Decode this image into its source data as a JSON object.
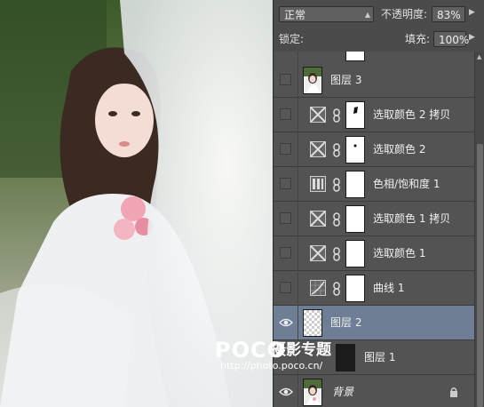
{
  "layers_panel": {
    "blend_mode": "正常",
    "opacity_label": "不透明度:",
    "opacity_value": "83%",
    "lock_label": "锁定:",
    "fill_label": "填充:",
    "fill_value": "100%",
    "layers": [
      {
        "name": "图层 3",
        "type": "pixel",
        "visible": false
      },
      {
        "name": "选取颜色 2 拷贝",
        "type": "selective-color",
        "visible": false
      },
      {
        "name": "选取颜色 2",
        "type": "selective-color",
        "visible": false
      },
      {
        "name": "色相/饱和度 1",
        "type": "hue-saturation",
        "visible": false
      },
      {
        "name": "选取颜色 1 拷贝",
        "type": "selective-color",
        "visible": false
      },
      {
        "name": "选取颜色 1",
        "type": "selective-color",
        "visible": false
      },
      {
        "name": "曲线 1",
        "type": "curves",
        "visible": false
      },
      {
        "name": "图层 2",
        "type": "transparent",
        "visible": true,
        "selected": true
      },
      {
        "name": "图层 1",
        "type": "dark",
        "visible": false
      },
      {
        "name": "背景",
        "type": "background",
        "visible": true,
        "locked": true
      }
    ]
  },
  "watermark": {
    "logo": "POCO",
    "subtitle": "摄影专题",
    "url": "http://photo.poco.cn/"
  },
  "colors": {
    "panel_bg": "#535353",
    "selected_row": "#6e7e94"
  }
}
